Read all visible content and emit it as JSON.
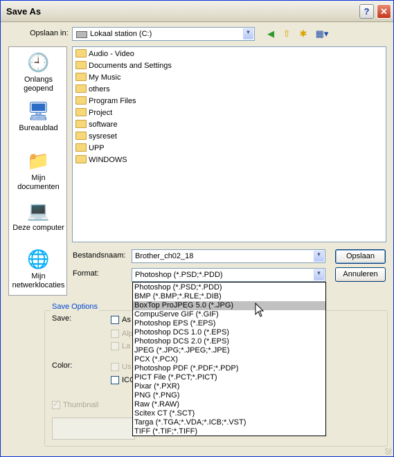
{
  "window": {
    "title": "Save As",
    "help_glyph": "?",
    "close_glyph": "✕"
  },
  "location": {
    "label": "Opslaan in:",
    "value": "Lokaal station (C:)"
  },
  "places": [
    {
      "label1": "Onlangs",
      "label2": "geopend",
      "icon": "recent-icon"
    },
    {
      "label1": "Bureaublad",
      "label2": "",
      "icon": "desktop-icon"
    },
    {
      "label1": "Mijn",
      "label2": "documenten",
      "icon": "my-documents-icon"
    },
    {
      "label1": "Deze computer",
      "label2": "",
      "icon": "my-computer-icon"
    },
    {
      "label1": "Mijn",
      "label2": "netwerklocaties",
      "icon": "network-icon"
    }
  ],
  "files": [
    "Audio - Video",
    "Documents and Settings",
    "My Music",
    "others",
    "Program Files",
    "Project",
    "software",
    "sysreset",
    "UPP",
    "WINDOWS"
  ],
  "filename": {
    "label": "Bestandsnaam:",
    "value": "Brother_ch02_18"
  },
  "format": {
    "label": "Format:",
    "value": "Photoshop (*.PSD;*.PDD)"
  },
  "buttons": {
    "save": "Opslaan",
    "cancel": "Annuleren"
  },
  "save_options": {
    "title": "Save Options",
    "save_label": "Save:",
    "as_label": "As",
    "alpha_label": "Alp",
    "layers_label": "La",
    "color_label": "Color:",
    "use_label": "Us",
    "icc_label": "ICC",
    "thumbnail_label": "Thumbnail"
  },
  "format_options": [
    "Photoshop (*.PSD;*.PDD)",
    "BMP (*.BMP;*.RLE;*.DIB)",
    "BoxTop ProJPEG 5.0 (*.JPG)",
    "CompuServe GIF (*.GIF)",
    "Photoshop EPS (*.EPS)",
    "Photoshop DCS 1.0 (*.EPS)",
    "Photoshop DCS 2.0 (*.EPS)",
    "JPEG (*.JPG;*.JPEG;*.JPE)",
    "PCX (*.PCX)",
    "Photoshop PDF (*.PDF;*.PDP)",
    "PICT File (*.PCT;*.PICT)",
    "Pixar (*.PXR)",
    "PNG (*.PNG)",
    "Raw (*.RAW)",
    "Scitex CT (*.SCT)",
    "Targa (*.TGA;*.VDA;*.ICB;*.VST)",
    "TIFF (*.TIF;*.TIFF)"
  ],
  "highlighted_option": "BoxTop ProJPEG 5.0 (*.JPG)"
}
